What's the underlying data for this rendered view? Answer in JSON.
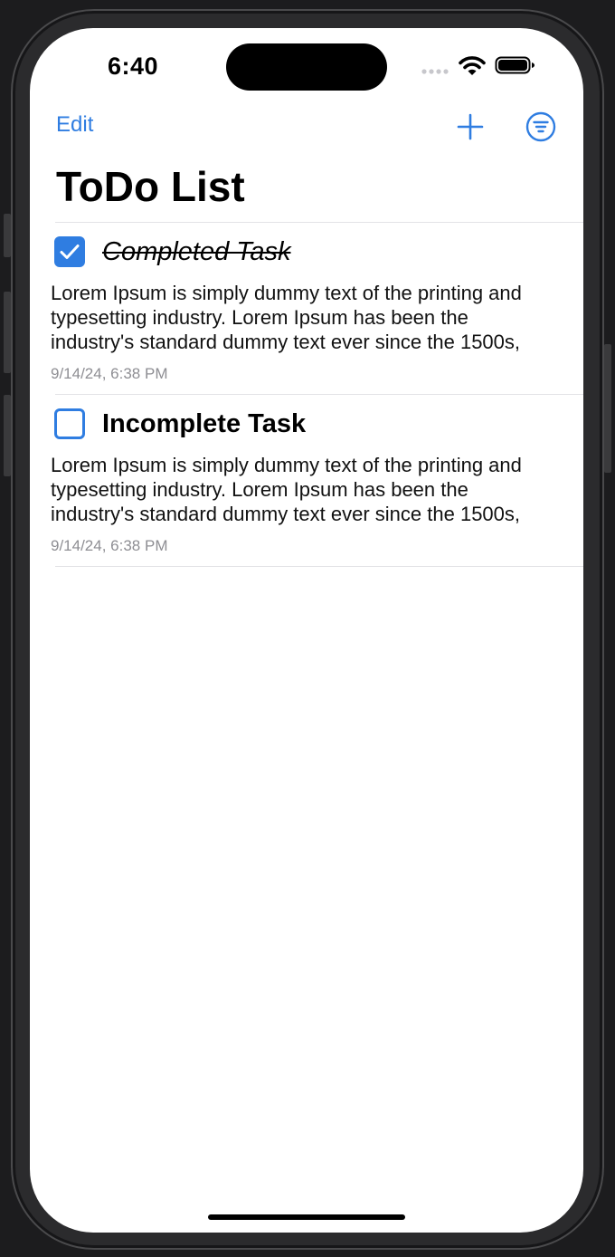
{
  "status_bar": {
    "time": "6:40"
  },
  "nav": {
    "edit_label": "Edit",
    "add_icon": "plus-icon",
    "filter_icon": "filter-circle-icon"
  },
  "page": {
    "title": "ToDo List"
  },
  "tasks": [
    {
      "title": "Completed Task",
      "completed": true,
      "description": "Lorem Ipsum is simply dummy text of the printing and\ntypesetting industry. Lorem Ipsum has been the\nindustry's standard dummy text ever since the 1500s,",
      "timestamp": "9/14/24, 6:38 PM"
    },
    {
      "title": "Incomplete Task",
      "completed": false,
      "description": "Lorem Ipsum is simply dummy text of the printing and\ntypesetting industry. Lorem Ipsum has been the\nindustry's standard dummy text ever since the 1500s,",
      "timestamp": "9/14/24, 6:38 PM"
    }
  ],
  "colors": {
    "accent": "#2f7de1",
    "secondary_text": "#8e8e93",
    "divider": "#e3e3e6"
  }
}
